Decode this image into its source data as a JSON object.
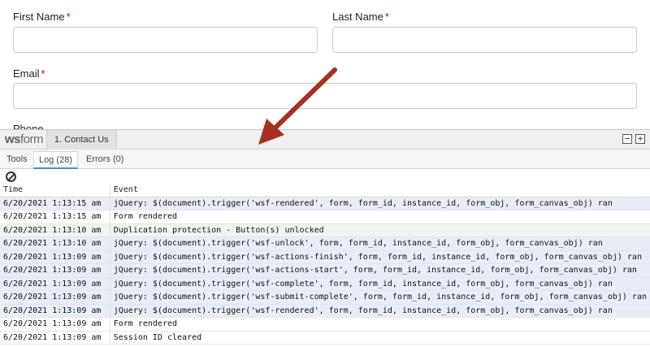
{
  "form": {
    "first_name_label": "First Name",
    "last_name_label": "Last Name",
    "email_label": "Email",
    "phone_label": "Phone",
    "required_mark": "*",
    "first_name_value": "",
    "last_name_value": "",
    "email_value": ""
  },
  "console": {
    "logo_bold": "ws",
    "logo_rest": "form",
    "form_tab": "1. Contact Us",
    "minimize": "−",
    "maximize": "+",
    "tabs": [
      {
        "label": "Tools"
      },
      {
        "label": "Log (28)",
        "active": true
      },
      {
        "label": "Errors (0)"
      }
    ],
    "columns": {
      "time": "Time",
      "event": "Event"
    },
    "rows": [
      {
        "time": "6/20/2021 1:13:15 am",
        "event": "jQuery: $(document).trigger('wsf-rendered', form, form_id, instance_id, form_obj, form_canvas_obj) ran",
        "kind": "jq"
      },
      {
        "time": "6/20/2021 1:13:15 am",
        "event": "Form rendered",
        "kind": "info"
      },
      {
        "time": "6/20/2021 1:13:10 am",
        "event": "Duplication protection - Button(s) unlocked",
        "kind": "ok"
      },
      {
        "time": "6/20/2021 1:13:10 am",
        "event": "jQuery: $(document).trigger('wsf-unlock', form, form_id, instance_id, form_obj, form_canvas_obj) ran",
        "kind": "jq"
      },
      {
        "time": "6/20/2021 1:13:09 am",
        "event": "jQuery: $(document).trigger('wsf-actions-finish', form, form_id, instance_id, form_obj, form_canvas_obj) ran",
        "kind": "jq"
      },
      {
        "time": "6/20/2021 1:13:09 am",
        "event": "jQuery: $(document).trigger('wsf-actions-start', form, form_id, instance_id, form_obj, form_canvas_obj) ran",
        "kind": "jq"
      },
      {
        "time": "6/20/2021 1:13:09 am",
        "event": "jQuery: $(document).trigger('wsf-complete', form, form_id, instance_id, form_obj, form_canvas_obj) ran",
        "kind": "jq"
      },
      {
        "time": "6/20/2021 1:13:09 am",
        "event": "jQuery: $(document).trigger('wsf-submit-complete', form, form_id, instance_id, form_obj, form_canvas_obj) ran",
        "kind": "jq"
      },
      {
        "time": "6/20/2021 1:13:09 am",
        "event": "jQuery: $(document).trigger('wsf-rendered', form, form_id, instance_id, form_obj, form_canvas_obj) ran",
        "kind": "jq"
      },
      {
        "time": "6/20/2021 1:13:09 am",
        "event": "Form rendered",
        "kind": "info"
      },
      {
        "time": "6/20/2021 1:13:09 am",
        "event": "Session ID cleared",
        "kind": "info"
      }
    ]
  },
  "colors": {
    "required": "#d0021b",
    "arrow": "#a8301f",
    "active_tab_underline": "#3d8fd9",
    "jquery_row": "#e8eef7",
    "ok_row": "#eef6ee"
  },
  "icons": {
    "clear": "clear-log-icon",
    "annotation": "arrow-annotation"
  }
}
